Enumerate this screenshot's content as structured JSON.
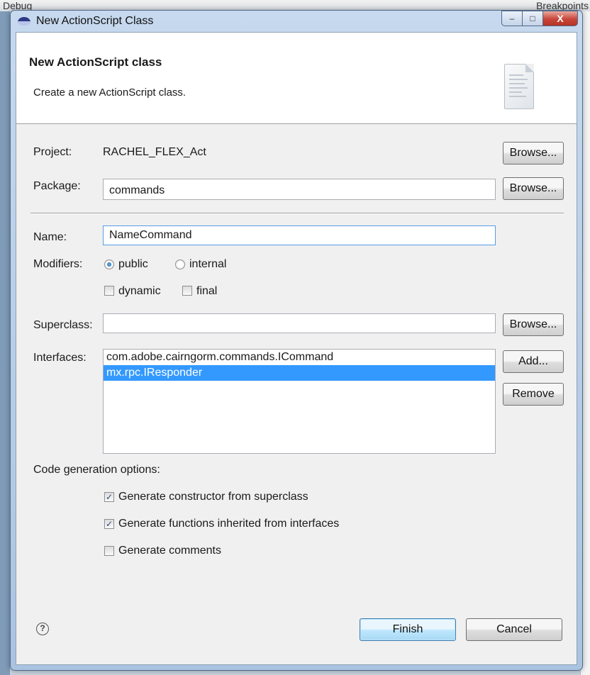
{
  "background": {
    "debug_tab": "Debug",
    "breakpoints_tab": "Breakpoints"
  },
  "window": {
    "title": "New ActionScript Class",
    "buttons": {
      "minimize": "–",
      "maximize": "□",
      "close": "X"
    }
  },
  "header": {
    "title": "New ActionScript class",
    "subtitle": "Create a new ActionScript class."
  },
  "form": {
    "project_label": "Project:",
    "project_value": "RACHEL_FLEX_Act",
    "package_label": "Package:",
    "package_value": "commands",
    "name_label": "Name:",
    "name_value": "NameCommand",
    "modifiers_label": "Modifiers:",
    "modifier_public": "public",
    "modifier_internal": "internal",
    "modifier_dynamic": "dynamic",
    "modifier_final": "final",
    "superclass_label": "Superclass:",
    "superclass_value": "",
    "interfaces_label": "Interfaces:",
    "interfaces": [
      "com.adobe.cairngorm.commands.ICommand",
      "mx.rpc.IResponder"
    ],
    "selected_interface": 1,
    "browse_label": "Browse...",
    "add_label": "Add...",
    "remove_label": "Remove"
  },
  "codegen": {
    "section_label": "Code generation options:",
    "options": [
      {
        "label": "Generate constructor from superclass",
        "checked": true
      },
      {
        "label": "Generate functions inherited from interfaces",
        "checked": true
      },
      {
        "label": "Generate comments",
        "checked": false
      }
    ]
  },
  "footer": {
    "help_symbol": "?",
    "finish_label": "Finish",
    "cancel_label": "Cancel"
  }
}
